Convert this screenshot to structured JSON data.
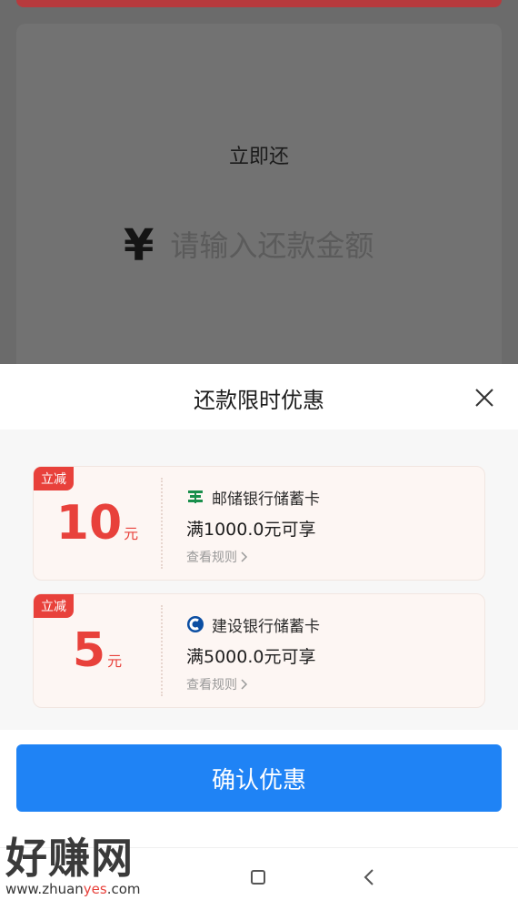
{
  "background": {
    "title": "立即还",
    "currency_symbol": "¥",
    "amount_placeholder": "请输入还款金额"
  },
  "sheet": {
    "title": "还款限时优惠",
    "close_icon": "close-icon"
  },
  "coupons": [
    {
      "tag": "立减",
      "value": "10",
      "unit": "元",
      "bank": "邮储银行储蓄卡",
      "bank_icon": "postal-bank-icon",
      "bank_color": "#1a8f4c",
      "condition": "满1000.0元可享",
      "rules": "查看规则",
      "rules_icon": "chevron-right-icon"
    },
    {
      "tag": "立减",
      "value": "5",
      "unit": "元",
      "bank": "建设银行储蓄卡",
      "bank_icon": "ccb-bank-icon",
      "bank_color": "#0b4ea2",
      "condition": "满5000.0元可享",
      "rules": "查看规则",
      "rules_icon": "chevron-right-icon"
    }
  ],
  "confirm_button": "确认优惠",
  "watermark": {
    "main": "好赚网",
    "sub_prefix": "www.zhuan",
    "sub_highlight": "yes",
    "sub_suffix": ".com"
  },
  "colors": {
    "accent_red": "#e8413b",
    "primary_blue": "#1f83f5"
  }
}
